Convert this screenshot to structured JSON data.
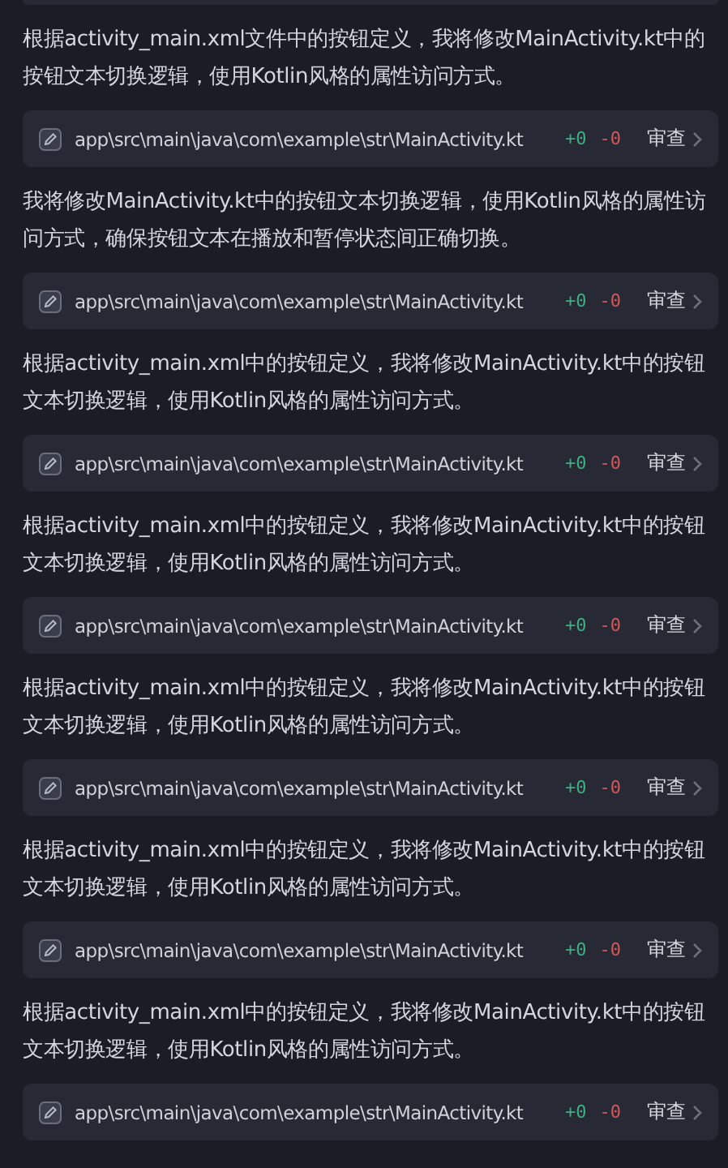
{
  "messages": [
    {
      "text": "根据activity_main.xml文件中的按钮定义，我将修改MainActivity.kt中的按钮文本切换逻辑，使用Kotlin风格的属性访问方式。",
      "file": {
        "path": "app\\src\\main\\java\\com\\example\\str\\MainActivity.kt",
        "added": "+0",
        "removed": "-0",
        "action": "审查"
      }
    },
    {
      "text": "我将修改MainActivity.kt中的按钮文本切换逻辑，使用Kotlin风格的属性访问方式，确保按钮文本在播放和暂停状态间正确切换。",
      "file": {
        "path": "app\\src\\main\\java\\com\\example\\str\\MainActivity.kt",
        "added": "+0",
        "removed": "-0",
        "action": "审查"
      }
    },
    {
      "text": "根据activity_main.xml中的按钮定义，我将修改MainActivity.kt中的按钮文本切换逻辑，使用Kotlin风格的属性访问方式。",
      "file": {
        "path": "app\\src\\main\\java\\com\\example\\str\\MainActivity.kt",
        "added": "+0",
        "removed": "-0",
        "action": "审查"
      }
    },
    {
      "text": "根据activity_main.xml中的按钮定义，我将修改MainActivity.kt中的按钮文本切换逻辑，使用Kotlin风格的属性访问方式。",
      "file": {
        "path": "app\\src\\main\\java\\com\\example\\str\\MainActivity.kt",
        "added": "+0",
        "removed": "-0",
        "action": "审查"
      }
    },
    {
      "text": "根据activity_main.xml中的按钮定义，我将修改MainActivity.kt中的按钮文本切换逻辑，使用Kotlin风格的属性访问方式。",
      "file": {
        "path": "app\\src\\main\\java\\com\\example\\str\\MainActivity.kt",
        "added": "+0",
        "removed": "-0",
        "action": "审查"
      }
    },
    {
      "text": "根据activity_main.xml中的按钮定义，我将修改MainActivity.kt中的按钮文本切换逻辑，使用Kotlin风格的属性访问方式。",
      "file": {
        "path": "app\\src\\main\\java\\com\\example\\str\\MainActivity.kt",
        "added": "+0",
        "removed": "-0",
        "action": "审查"
      }
    },
    {
      "text": "根据activity_main.xml中的按钮定义，我将修改MainActivity.kt中的按钮文本切换逻辑，使用Kotlin风格的属性访问方式。",
      "file": {
        "path": "app\\src\\main\\java\\com\\example\\str\\MainActivity.kt",
        "added": "+0",
        "removed": "-0",
        "action": "审查"
      }
    }
  ]
}
